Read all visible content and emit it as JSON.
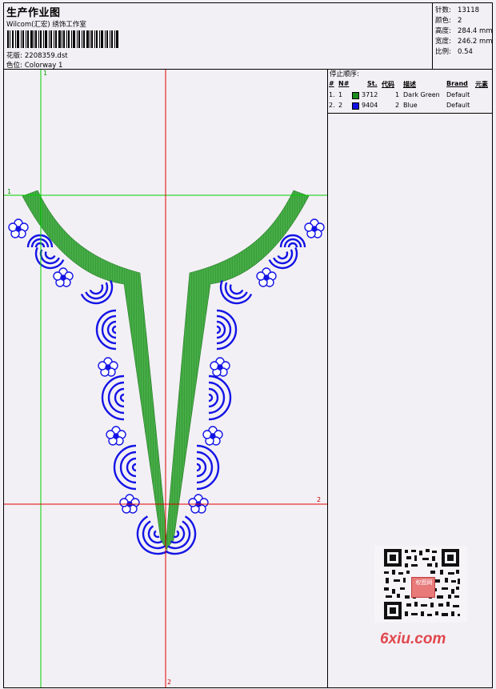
{
  "header": {
    "title": "生产作业图",
    "subtitle": "Wilcom(汇宏) 绣饰工作室",
    "design_label": "花版:",
    "design_value": "2208359.dst",
    "colorway_label": "色位:",
    "colorway_value": "Colorway 1"
  },
  "stats": {
    "stitches_label": "针数:",
    "stitches_value": "13118",
    "colors_label": "颜色:",
    "colors_value": "2",
    "height_label": "高度:",
    "height_value": "284.4 mm",
    "width_label": "宽度:",
    "width_value": "246.2 mm",
    "scale_label": "比例:",
    "scale_value": "0.54"
  },
  "stop_sequence": {
    "heading": "停止顺序:",
    "columns": [
      "#",
      "N#",
      "St.",
      "代码",
      "描述",
      "Brand",
      "元素"
    ],
    "rows": [
      {
        "idx": "1.",
        "n": "1",
        "color": "#1c8a1c",
        "st": "3712",
        "code": "1",
        "desc": "Dark Green",
        "brand": "Default"
      },
      {
        "idx": "2.",
        "n": "2",
        "color": "#1010e0",
        "st": "9404",
        "code": "2",
        "desc": "Blue",
        "brand": "Default"
      }
    ]
  },
  "guides": {
    "marker_1_top": "1",
    "marker_1_left": "1",
    "marker_2_right": "2",
    "marker_2_bottom": "2"
  },
  "watermark": {
    "text": "6xiu.com",
    "stamp": "权图网"
  },
  "colors": {
    "background": "#f3f0f5",
    "green_thread": "#3aa23a",
    "blue_thread": "#1414e6",
    "guide_green": "#00d000",
    "guide_red": "#e00000"
  }
}
